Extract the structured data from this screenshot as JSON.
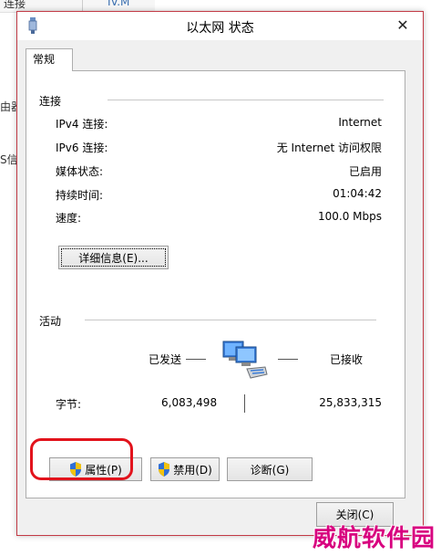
{
  "background": {
    "fragments": [
      "连接",
      "IV.M",
      "由器",
      "S信息"
    ]
  },
  "dialog": {
    "title": "以太网 状态",
    "tab": "常规",
    "connection": {
      "title": "连接",
      "rows": [
        {
          "label": "IPv4 连接:",
          "value": "Internet"
        },
        {
          "label": "IPv6 连接:",
          "value": "无 Internet 访问权限"
        },
        {
          "label": "媒体状态:",
          "value": "已启用"
        },
        {
          "label": "持续时间:",
          "value": "01:04:42"
        },
        {
          "label": "速度:",
          "value": "100.0 Mbps"
        }
      ],
      "details_button": "详细信息(E)..."
    },
    "activity": {
      "title": "活动",
      "sent_label": "已发送",
      "received_label": "已接收",
      "bytes_label": "字节:",
      "bytes_sent": "6,083,498",
      "bytes_received": "25,833,315"
    },
    "buttons": {
      "properties": "属性(P)",
      "disable": "禁用(D)",
      "diagnose": "诊断(G)",
      "close": "关闭(C)"
    }
  },
  "watermark": "威航软件园",
  "colors": {
    "window_border": "#c23a45",
    "highlight": "#e2131c",
    "watermark": "#d8007f"
  }
}
